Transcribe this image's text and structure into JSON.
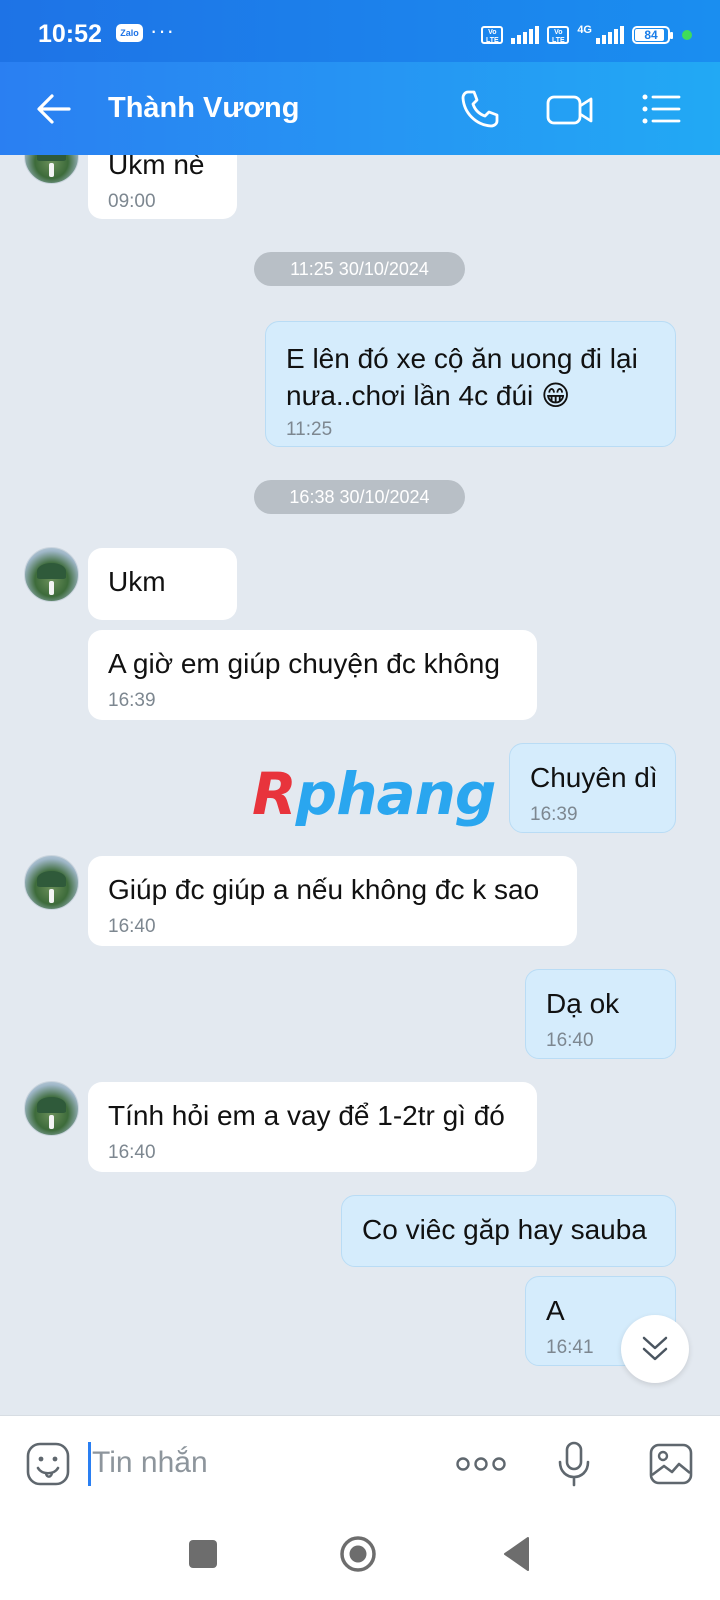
{
  "status_bar": {
    "time": "10:52",
    "app_badge": "Zalo",
    "dots": "···",
    "volte": "Vo\nLTE",
    "network": "4G",
    "battery": "84"
  },
  "header": {
    "title": "Thành Vương",
    "back_icon": "arrow-left-icon",
    "call_icon": "phone-icon",
    "video_icon": "video-icon",
    "menu_icon": "list-icon"
  },
  "chat": {
    "messages": [
      {
        "text": "Ukm nè",
        "time": "09:00"
      },
      {
        "date": "11:25 30/10/2024"
      },
      {
        "text": "E lên đó xe cộ ăn uong đi lại nưa..chơi lần 4c đúi 😁",
        "time": "11:25"
      },
      {
        "date": "16:38 30/10/2024"
      },
      {
        "text": "Ukm"
      },
      {
        "text": "A giờ em giúp chuyện đc không",
        "time": "16:39"
      },
      {
        "text": "Chuyên dì",
        "time": "16:39"
      },
      {
        "text": "Giúp đc giúp a nếu không đc k sao",
        "time": "16:40"
      },
      {
        "text": "Dạ ok",
        "time": "16:40"
      },
      {
        "text": "Tính hỏi em a vay để 1-2tr gì đó",
        "time": "16:40"
      },
      {
        "text": "Co viêc găp hay sauba"
      },
      {
        "text": "A",
        "time": "16:41"
      }
    ],
    "watermark": {
      "first": "R",
      "rest": "phang"
    }
  },
  "input": {
    "placeholder": "Tin nhắn"
  },
  "colors": {
    "header": "#2a7ff2",
    "outgoing_bubble": "#d5ecfc",
    "incoming_bubble": "#ffffff",
    "background": "#e3e9f0"
  }
}
